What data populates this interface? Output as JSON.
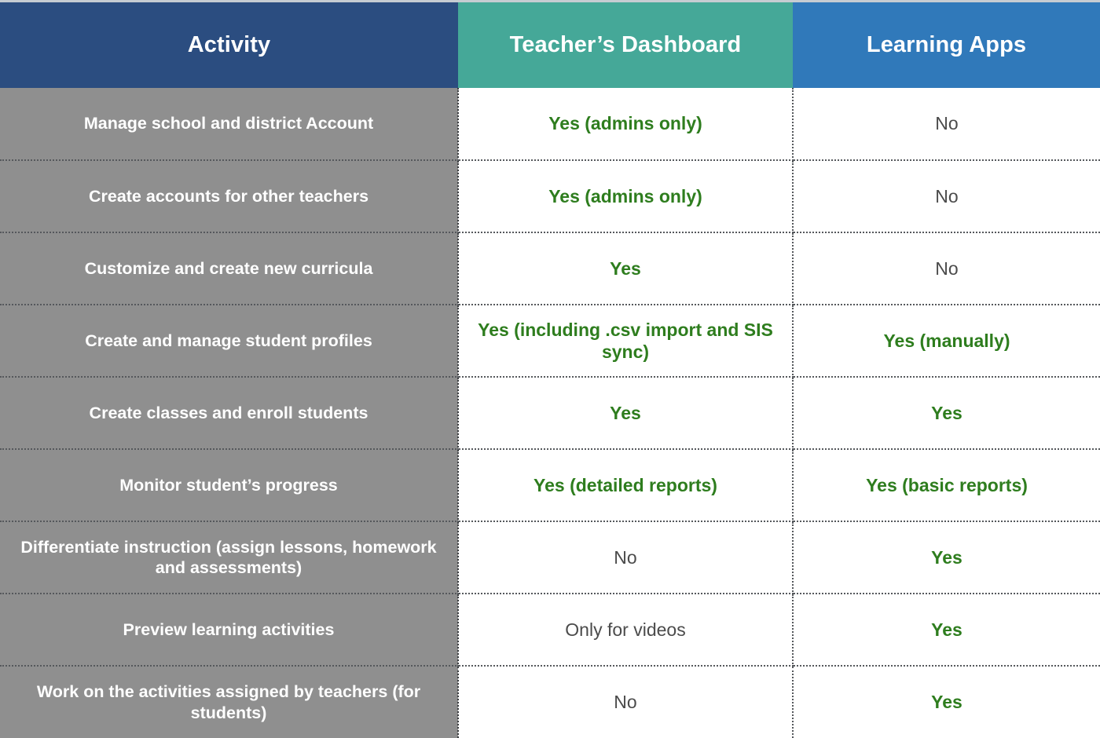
{
  "table": {
    "columns": [
      {
        "key": "activity",
        "label": "Activity",
        "color": "#2b4d80"
      },
      {
        "key": "dashboard",
        "label": "Teacher’s Dashboard",
        "color": "#45a898"
      },
      {
        "key": "apps",
        "label": "Learning Apps",
        "color": "#3079ba"
      }
    ],
    "colors": {
      "header_activity": "#2b4d80",
      "header_dashboard": "#45a898",
      "header_apps": "#3079ba",
      "activity_cell_bg": "#8f8f8f",
      "yes_text": "#2e7d1e",
      "no_text": "#4b4b4b",
      "grid_line": "#55585c",
      "page_bg": "#ffffff"
    },
    "rows": [
      {
        "activity": "Manage school and district Account",
        "dashboard": "Yes (admins only)",
        "dashboard_kind": "yes",
        "apps": "No",
        "apps_kind": "no"
      },
      {
        "activity": "Create accounts for other teachers",
        "dashboard": "Yes (admins only)",
        "dashboard_kind": "yes",
        "apps": "No",
        "apps_kind": "no"
      },
      {
        "activity": "Customize and create new curricula",
        "dashboard": "Yes",
        "dashboard_kind": "yes",
        "apps": "No",
        "apps_kind": "no"
      },
      {
        "activity": "Create and manage student profiles",
        "dashboard": "Yes (including .csv import and SIS sync)",
        "dashboard_kind": "yes",
        "apps": "Yes (manually)",
        "apps_kind": "yes"
      },
      {
        "activity": "Create classes and enroll students",
        "dashboard": "Yes",
        "dashboard_kind": "yes",
        "apps": "Yes",
        "apps_kind": "yes"
      },
      {
        "activity": "Monitor student’s progress",
        "dashboard": "Yes (detailed reports)",
        "dashboard_kind": "yes",
        "apps": "Yes (basic reports)",
        "apps_kind": "yes"
      },
      {
        "activity": "Differentiate instruction (assign lessons, homework and assessments)",
        "dashboard": "No",
        "dashboard_kind": "no",
        "apps": "Yes",
        "apps_kind": "yes"
      },
      {
        "activity": "Preview learning activities",
        "dashboard": "Only for videos",
        "dashboard_kind": "no",
        "apps": "Yes",
        "apps_kind": "yes"
      },
      {
        "activity": "Work on the activities assigned by teachers (for students)",
        "dashboard": "No",
        "dashboard_kind": "no",
        "apps": "Yes",
        "apps_kind": "yes"
      }
    ]
  }
}
